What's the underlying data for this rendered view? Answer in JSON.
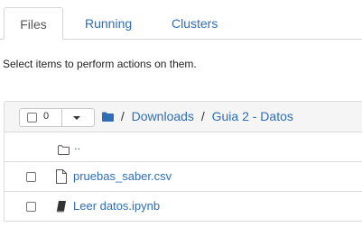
{
  "tabs": [
    {
      "label": "Files",
      "active": true
    },
    {
      "label": "Running",
      "active": false
    },
    {
      "label": "Clusters",
      "active": false
    }
  ],
  "hint_text": "Select items to perform actions on them.",
  "toolbar": {
    "selected_count": "0",
    "breadcrumb": [
      "Downloads",
      "Guia 2 - Datos"
    ],
    "breadcrumb_separator": "/"
  },
  "rows": [
    {
      "type": "parent-folder",
      "name": ".."
    },
    {
      "type": "file",
      "name": "pruebas_saber.csv",
      "icon": "file-icon"
    },
    {
      "type": "notebook",
      "name": "Leer datos.ipynb",
      "icon": "notebook-icon"
    }
  ],
  "colors": {
    "link": "#2f6eb5",
    "toolbar_bg": "#f5f5f5",
    "border": "#dddddd"
  }
}
